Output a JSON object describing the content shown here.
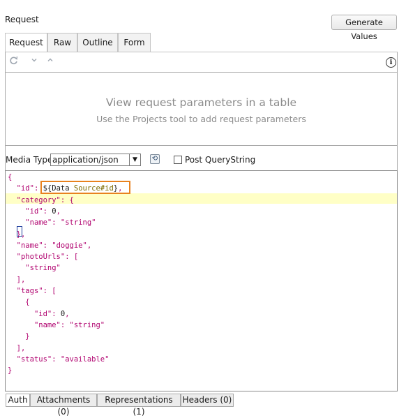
{
  "header": {
    "section_title": "Request",
    "generate_button": "Generate Values"
  },
  "tabs": [
    {
      "label": "Request",
      "active": true
    },
    {
      "label": "Raw",
      "active": false
    },
    {
      "label": "Outline",
      "active": false
    },
    {
      "label": "Form",
      "active": false
    }
  ],
  "toolbar": {
    "icons": [
      "refresh-icon",
      "chevron-down-icon",
      "chevron-up-icon",
      "info-icon"
    ],
    "info_glyph": "i"
  },
  "params": {
    "title": "View request parameters in a table",
    "subtitle": "Use the Projects tool to add request parameters"
  },
  "media": {
    "label": "Media Type",
    "value": "application/json",
    "post_querystring_label": "Post QueryString",
    "post_querystring_checked": false
  },
  "editor": {
    "lines": [
      "{",
      "  \"id\": ${Data Source#id},",
      "  \"category\": {",
      "    \"id\": 0,",
      "    \"name\": \"string\"",
      "  },",
      "  \"name\": \"doggie\",",
      "  \"photoUrls\": [",
      "    \"string\"",
      "  ],",
      "  \"tags\": [",
      "    {",
      "      \"id\": 0,",
      "      \"name\": \"string\"",
      "    }",
      "  ],",
      "  \"status\": \"available\"",
      "}"
    ],
    "highlighted_line_index": 2
  },
  "bottom_tabs": [
    {
      "label": "Auth"
    },
    {
      "label": "Attachments (0)"
    },
    {
      "label": "Representations (1)"
    },
    {
      "label": "Headers (0)"
    }
  ],
  "colors": {
    "key": "#b0006e",
    "expression": "#7a6a00",
    "highlight": "#ffffc6",
    "focus_box": "#e8821e"
  }
}
